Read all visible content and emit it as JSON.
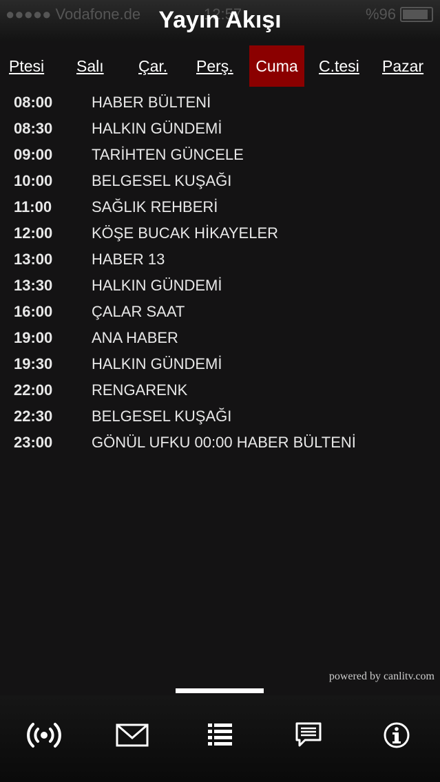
{
  "status_bar": {
    "carrier": "●●●●● Vodafone.de",
    "time": "12:57",
    "battery": "%96"
  },
  "header": {
    "title": "Yayın Akışı"
  },
  "days": [
    {
      "label": "Ptesi",
      "active": false
    },
    {
      "label": "Salı",
      "active": false
    },
    {
      "label": "Çar.",
      "active": false
    },
    {
      "label": "Perş.",
      "active": false
    },
    {
      "label": "Cuma",
      "active": true
    },
    {
      "label": "C.tesi",
      "active": false
    },
    {
      "label": "Pazar",
      "active": false
    }
  ],
  "schedule": [
    {
      "time": "08:00",
      "program": "HABER BÜLTENİ"
    },
    {
      "time": "08:30",
      "program": "HALKIN GÜNDEMİ"
    },
    {
      "time": "09:00",
      "program": "TARİHTEN GÜNCELE"
    },
    {
      "time": "10:00",
      "program": "BELGESEL KUŞAĞI"
    },
    {
      "time": "11:00",
      "program": "SAĞLIK REHBERİ"
    },
    {
      "time": "12:00",
      "program": "KÖŞE BUCAK HİKAYELER"
    },
    {
      "time": "13:00",
      "program": "HABER 13"
    },
    {
      "time": "13:30",
      "program": "HALKIN GÜNDEMİ"
    },
    {
      "time": "16:00",
      "program": "ÇALAR SAAT"
    },
    {
      "time": "19:00",
      "program": "ANA HABER"
    },
    {
      "time": "19:30",
      "program": "HALKIN GÜNDEMİ"
    },
    {
      "time": "22:00",
      "program": "RENGARENK"
    },
    {
      "time": "22:30",
      "program": "BELGESEL KUŞAĞI"
    },
    {
      "time": "23:00",
      "program": "GÖNÜL UFKU 00:00 HABER BÜLTENİ"
    }
  ],
  "footer": {
    "powered_by": "powered by canlitv.com"
  },
  "tabbar": {
    "items": [
      {
        "icon": "broadcast-icon"
      },
      {
        "icon": "mail-icon"
      },
      {
        "icon": "list-icon"
      },
      {
        "icon": "message-icon"
      },
      {
        "icon": "info-icon"
      }
    ]
  },
  "colors": {
    "active_day": "#8b0000",
    "background": "#141314"
  }
}
